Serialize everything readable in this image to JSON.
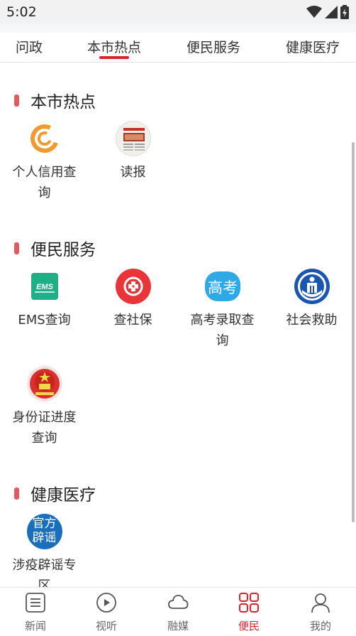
{
  "status": {
    "time": "5:02"
  },
  "tabs": [
    {
      "label": "问政",
      "active": false
    },
    {
      "label": "本市热点",
      "active": true
    },
    {
      "label": "便民服务",
      "active": false
    },
    {
      "label": "健康医疗",
      "active": false
    }
  ],
  "sections": [
    {
      "title": "本市热点",
      "items": [
        {
          "label": "个人信用查询",
          "icon": "credit-query-icon"
        },
        {
          "label": "读报",
          "icon": "newspaper-icon"
        }
      ]
    },
    {
      "title": "便民服务",
      "items": [
        {
          "label": "EMS查询",
          "icon": "ems-icon",
          "icon_text": "EMS"
        },
        {
          "label": "查社保",
          "icon": "social-security-icon"
        },
        {
          "label": "高考录取查询",
          "icon": "gaokao-icon",
          "icon_text": "高考"
        },
        {
          "label": "社会救助",
          "icon": "social-aid-icon"
        },
        {
          "label": "身份证进度查询",
          "icon": "id-card-emblem-icon"
        }
      ]
    },
    {
      "title": "健康医疗",
      "items": [
        {
          "label": "涉疫辟谣专区",
          "icon": "rumor-refute-icon",
          "icon_text": "官方辟谣"
        }
      ]
    }
  ],
  "bottom_nav": [
    {
      "label": "新闻",
      "icon": "news-icon",
      "active": false
    },
    {
      "label": "视听",
      "icon": "play-icon",
      "active": false
    },
    {
      "label": "融媒",
      "icon": "cloud-icon",
      "active": false
    },
    {
      "label": "便民",
      "icon": "grid-icon",
      "active": true
    },
    {
      "label": "我的",
      "icon": "person-icon",
      "active": false
    }
  ],
  "colors": {
    "accent": "#d9242e",
    "section_marker": "#e05a5f",
    "ems_green": "#1fae86",
    "gaokao_blue": "#2fa9e6",
    "aid_blue": "#1a56b0",
    "rumor_blue": "#1a6fb8"
  }
}
